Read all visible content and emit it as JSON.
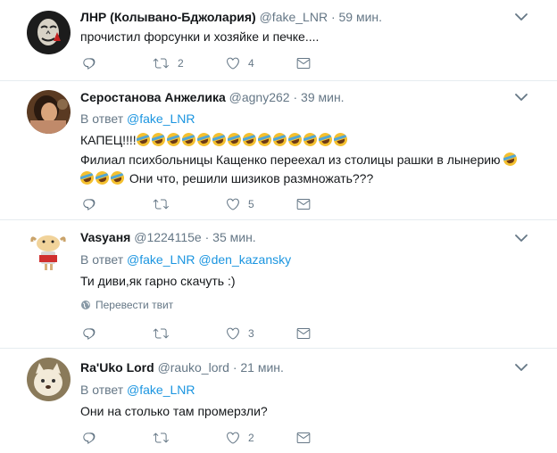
{
  "tweets": [
    {
      "name": "ЛНР (Колывано-Бджолария)",
      "handle": "@fake_LNR",
      "time": "59 мин.",
      "text_lines": [
        "прочистил форсунки и хозяйке и печке...."
      ],
      "replies": "",
      "retweets": "2",
      "likes": "4"
    },
    {
      "name": "Серостанова Анжелика",
      "handle": "@agny262",
      "time": "39 мин.",
      "reply_prefix": "В ответ",
      "reply_to": [
        "@fake_LNR"
      ],
      "text_lines": [
        "КАПЕЦ!!!!",
        "Филиал психбольницы Кащенко переехал из столицы рашки в лынерию",
        "Они что, решили шизиков размножать???"
      ],
      "replies": "",
      "retweets": "",
      "likes": "5"
    },
    {
      "name": "Vasyаня",
      "handle": "@1224115e",
      "time": "35 мин.",
      "reply_prefix": "В ответ",
      "reply_to": [
        "@fake_LNR",
        "@den_kazansky"
      ],
      "text_lines": [
        "Ти диви,як гарно скачуть :)"
      ],
      "translate": "Перевести твит",
      "replies": "",
      "retweets": "",
      "likes": "3"
    },
    {
      "name": "Ra'Uko Lord",
      "handle": "@rauko_lord",
      "time": "21 мин.",
      "reply_prefix": "В ответ",
      "reply_to": [
        "@fake_LNR"
      ],
      "text_lines": [
        "Они на столько там промерзли?"
      ],
      "replies": "",
      "retweets": "",
      "likes": "2"
    }
  ],
  "separator": "·",
  "colors": {
    "text": "#14171a",
    "muted": "#657786",
    "link": "#1b95e0",
    "divider": "#e6ecf0"
  }
}
